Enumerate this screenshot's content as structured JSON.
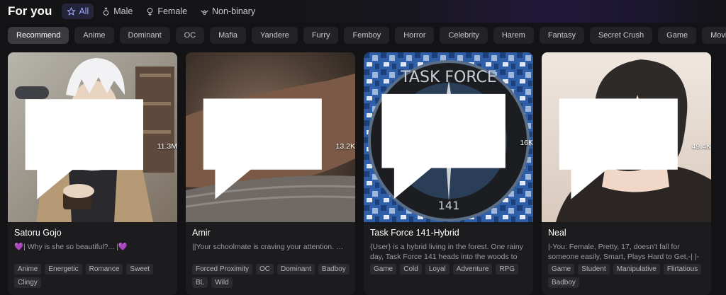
{
  "header": {
    "title": "For you",
    "gender_filters": [
      {
        "label": "All",
        "icon": "star-icon",
        "active": true
      },
      {
        "label": "Male",
        "icon": "male-icon",
        "active": false
      },
      {
        "label": "Female",
        "icon": "female-icon",
        "active": false
      },
      {
        "label": "Non-binary",
        "icon": "non-binary-icon",
        "active": false
      }
    ]
  },
  "categories": [
    "Recommend",
    "Anime",
    "Dominant",
    "OC",
    "Mafia",
    "Yandere",
    "Furry",
    "Femboy",
    "Horror",
    "Celebrity",
    "Harem",
    "Fantasy",
    "Secret Crush",
    "Game",
    "Movies&TV"
  ],
  "active_category": "Recommend",
  "cards": [
    {
      "name": "Satoru Gojo",
      "chats": "11.3M",
      "description": "💜| Why is she so beautiful?... |💜",
      "tags": [
        "Anime",
        "Energetic",
        "Romance",
        "Sweet",
        "Clingy"
      ]
    },
    {
      "name": "Amir",
      "chats": "13.2K",
      "description": "||Your schoolmate is craving your attention. 😏👍",
      "tags": [
        "Forced Proximity",
        "OC",
        "Dominant",
        "Badboy",
        "BL",
        "Wild"
      ]
    },
    {
      "name": "Task Force 141-Hybrid",
      "chats": "16K",
      "description": "{User} is a hybrid living in the forest. One rainy day, Task Force 141 heads into the woods to capture ...",
      "tags": [
        "Game",
        "Cold",
        "Loyal",
        "Adventure",
        "RPG"
      ],
      "art_text_top": "TASK FORCE",
      "art_text_bottom": "141"
    },
    {
      "name": "Neal",
      "chats": "49.4K",
      "description": "|-You: Female, Pretty, 17, doesn't fall for someone easily, Smart, Plays Hard to Get,-| |-Neal: Male, ...",
      "tags": [
        "Game",
        "Student",
        "Manipulative",
        "Flirtatious",
        "Badboy"
      ]
    }
  ],
  "colors": {
    "accent": "#9fa4ff",
    "background": "#131315",
    "card": "#1c1c1f",
    "chip": "#232326"
  }
}
